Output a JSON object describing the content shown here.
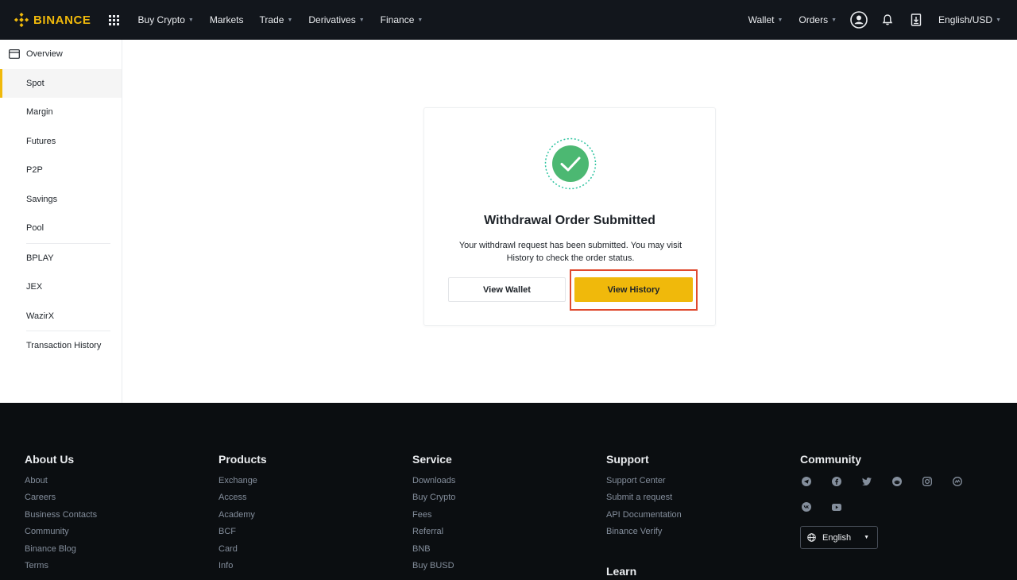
{
  "header": {
    "brand": "BINANCE",
    "nav": [
      {
        "label": "Buy Crypto",
        "caret": true
      },
      {
        "label": "Markets",
        "caret": false
      },
      {
        "label": "Trade",
        "caret": true
      },
      {
        "label": "Derivatives",
        "caret": true
      },
      {
        "label": "Finance",
        "caret": true
      }
    ],
    "wallet_label": "Wallet",
    "orders_label": "Orders",
    "lang_currency": "English/USD"
  },
  "sidebar": {
    "items": [
      "Overview",
      "Spot",
      "Margin",
      "Futures",
      "P2P",
      "Savings",
      "Pool",
      "BPLAY",
      "JEX",
      "WazirX",
      "Transaction History"
    ],
    "active": "Spot"
  },
  "card": {
    "title": "Withdrawal Order Submitted",
    "message_line1": "Your withdrawl request has been submitted. You may visit",
    "message_line2": "History to check the order status.",
    "view_wallet": "View Wallet",
    "view_history": "View History"
  },
  "footer": {
    "columns": [
      {
        "title": "About Us",
        "links": [
          "About",
          "Careers",
          "Business Contacts",
          "Community",
          "Binance Blog",
          "Terms"
        ]
      },
      {
        "title": "Products",
        "links": [
          "Exchange",
          "Access",
          "Academy",
          "BCF",
          "Card",
          "Info"
        ]
      },
      {
        "title": "Service",
        "links": [
          "Downloads",
          "Buy Crypto",
          "Fees",
          "Referral",
          "BNB",
          "Buy BUSD"
        ]
      },
      {
        "title": "Support",
        "links": [
          "Support Center",
          "Submit a request",
          "API Documentation",
          "Binance Verify"
        ]
      }
    ],
    "learn": "Learn",
    "community": "Community",
    "social_icons": [
      "telegram-icon",
      "facebook-icon",
      "twitter-icon",
      "reddit-icon",
      "instagram-icon",
      "coinmarketcap-icon",
      "vk-icon",
      "youtube-icon"
    ],
    "language": "English"
  },
  "colors": {
    "brand": "#F0B90B",
    "success": "#4CB872",
    "highlight": "#E04A2F"
  }
}
